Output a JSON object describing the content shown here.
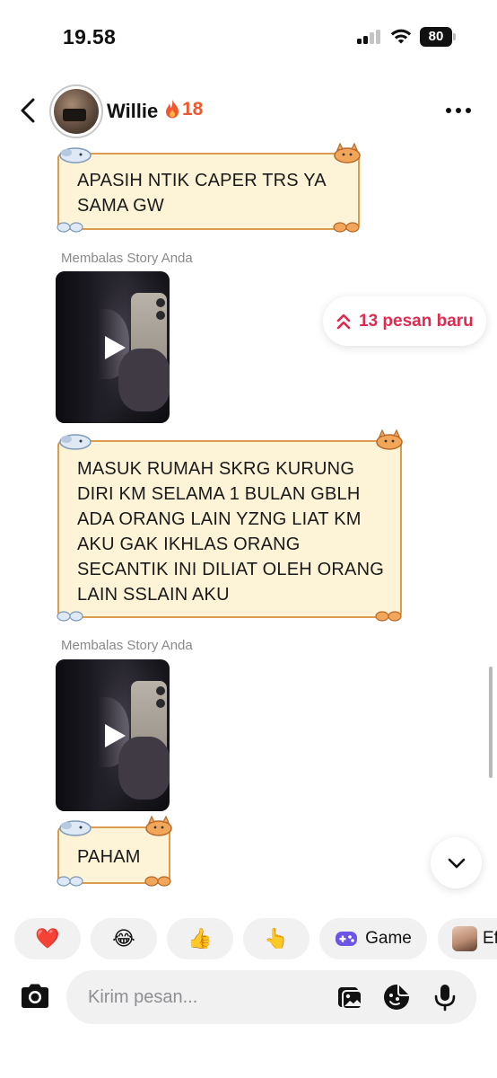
{
  "status_bar": {
    "time": "19.58",
    "battery": "80"
  },
  "header": {
    "contact_name": "Willie",
    "streak_count": "18",
    "icons": [
      "back-arrow-icon",
      "flame-icon",
      "more-icon"
    ]
  },
  "messages": [
    {
      "type": "text",
      "text": "APASIH NTIK CAPER TRS YA SAMA GW"
    },
    {
      "type": "story_reply",
      "label": "Membalas Story Anda"
    },
    {
      "type": "text",
      "text": "MASUK RUMAH SKRG KURUNG DIRI KM SELAMA 1 BULAN GBLH ADA ORANG LAIN YZNG LIAT KM AKU GAK IKHLAS ORANG SECANTIK INI DILIAT OLEH ORANG LAIN SSLAIN AKU"
    },
    {
      "type": "story_reply",
      "label": "Membalas Story Anda"
    },
    {
      "type": "text",
      "text": "PAHAM"
    }
  ],
  "new_messages_pill": {
    "label": "13 pesan baru",
    "color": "#e2294f"
  },
  "quick_replies": [
    {
      "emoji": "❤️",
      "name": "heart"
    },
    {
      "emoji": "😂",
      "name": "laughing"
    },
    {
      "emoji": "👍",
      "name": "thumbs-up"
    },
    {
      "emoji": "👆",
      "name": "pointing-up"
    },
    {
      "label": "Game",
      "icon": "gamepad-icon"
    },
    {
      "label": "Ef",
      "icon": "effect-thumbnail"
    }
  ],
  "composer": {
    "placeholder": "Kirim pesan..."
  },
  "colors": {
    "accent": "#e2294f",
    "streak": "#f1572f",
    "note_fill": "#fdf3d6",
    "note_border": "#dc9b4e"
  }
}
